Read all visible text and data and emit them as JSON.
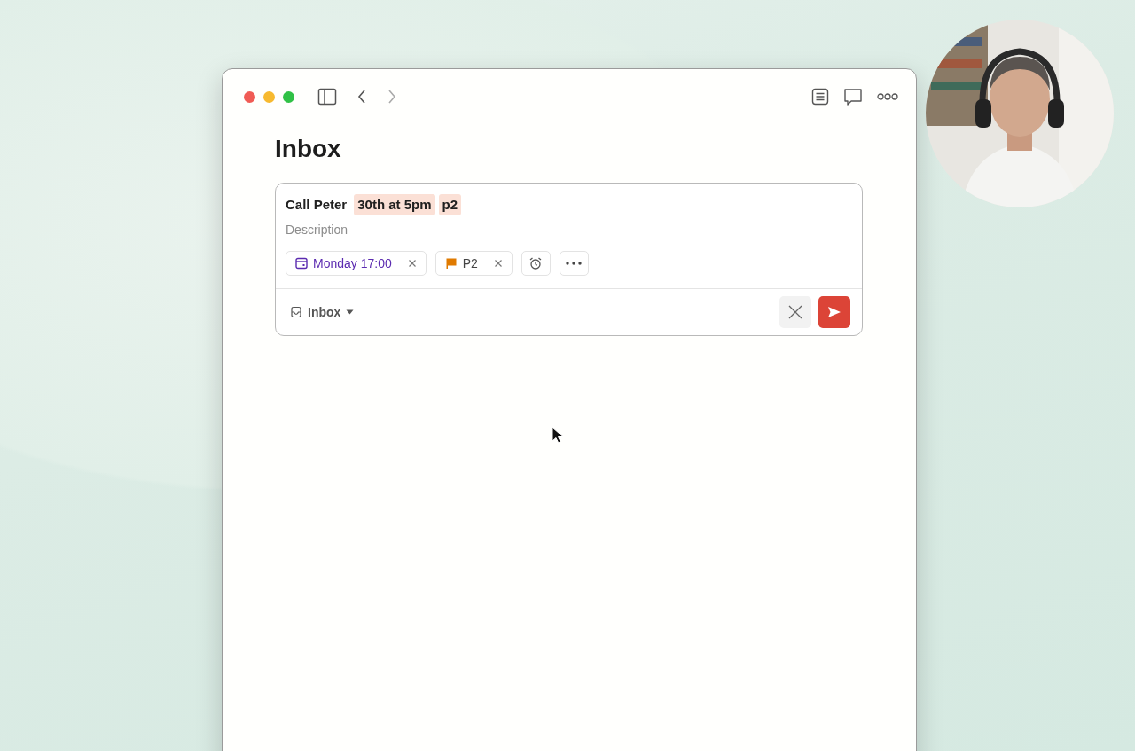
{
  "window": {
    "title": "Inbox"
  },
  "task_editor": {
    "title_segments": [
      {
        "text": "Call Peter",
        "highlighted": false
      },
      {
        "text": "30th at 5pm",
        "highlighted": true
      },
      {
        "text": "p2",
        "highlighted": true
      }
    ],
    "description": {
      "placeholder": "Description"
    },
    "chips": [
      {
        "kind": "date",
        "label": "Monday 17:00",
        "removable": true
      },
      {
        "kind": "priority",
        "label": "P2",
        "removable": true
      },
      {
        "kind": "reminder"
      },
      {
        "kind": "more"
      }
    ],
    "project": {
      "label": "Inbox"
    }
  }
}
